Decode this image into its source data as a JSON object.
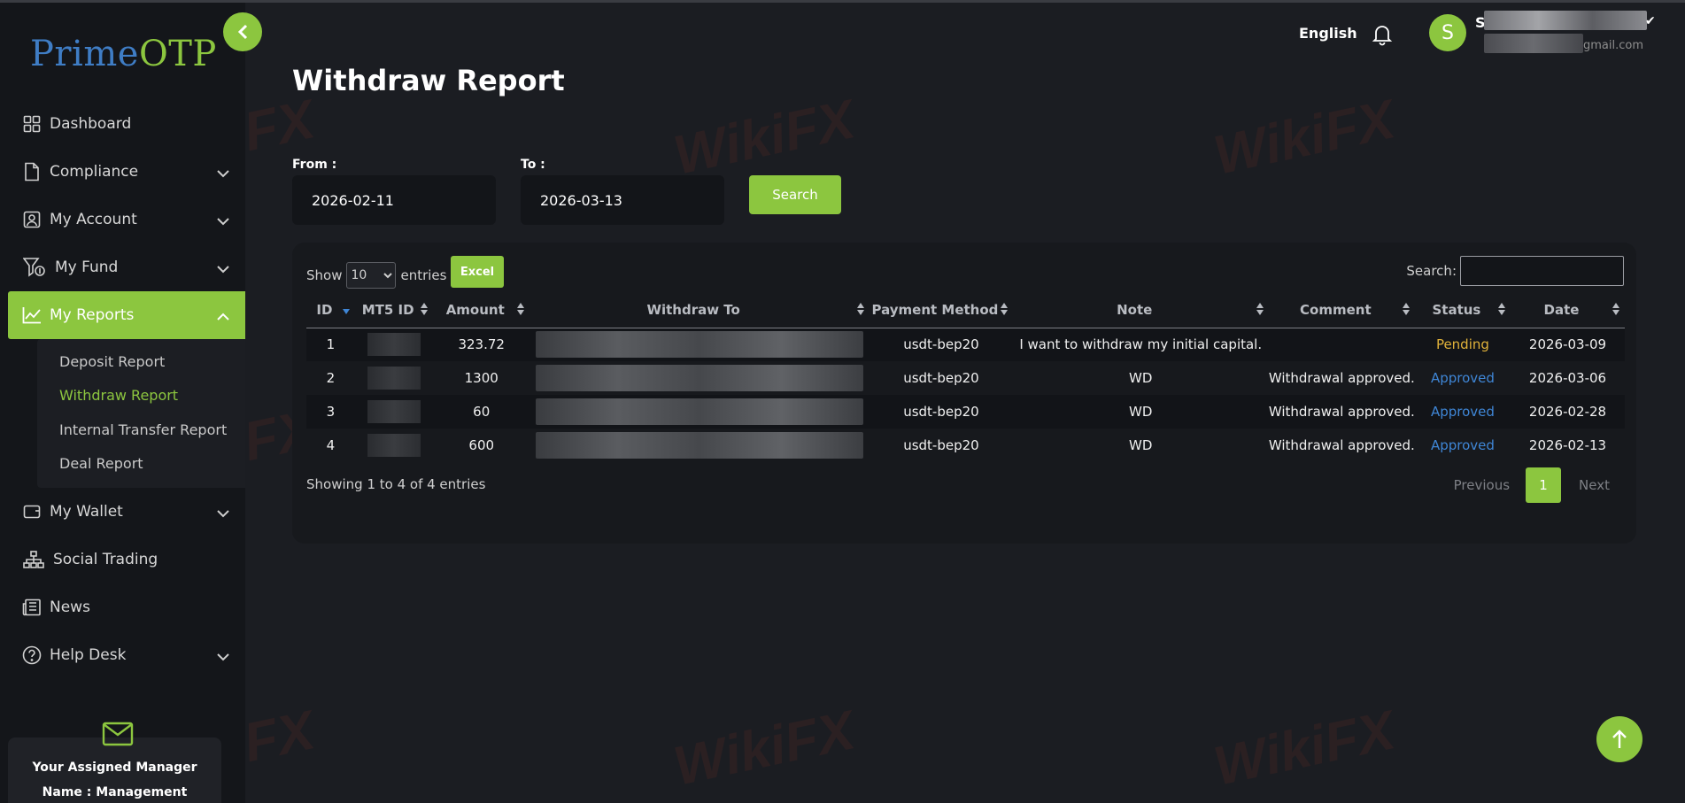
{
  "brand": {
    "part1": "Prime",
    "part2": "OTP"
  },
  "header": {
    "language": "English",
    "avatar_initial": "S",
    "user_name": "S",
    "user_email": "gmail.com"
  },
  "sidebar": {
    "items": [
      {
        "label": "Dashboard",
        "icon": "dashboard-icon"
      },
      {
        "label": "Compliance",
        "icon": "document-icon"
      },
      {
        "label": "My Account",
        "icon": "user-icon"
      },
      {
        "label": "My Fund",
        "icon": "fund-icon"
      },
      {
        "label": "My Reports",
        "icon": "chart-icon"
      },
      {
        "label": "My Wallet",
        "icon": "wallet-icon"
      },
      {
        "label": "Social Trading",
        "icon": "network-icon"
      },
      {
        "label": "News",
        "icon": "news-icon"
      },
      {
        "label": "Help Desk",
        "icon": "help-icon"
      }
    ],
    "reports_sub": [
      "Deposit Report",
      "Withdraw Report",
      "Internal Transfer Report",
      "Deal Report"
    ],
    "manager_title": "Your Assigned Manager",
    "manager_name": "Name : Management"
  },
  "page": {
    "title": "Withdraw Report"
  },
  "filter": {
    "from_label": "From :",
    "from_value": "2026-02-11",
    "to_label": "To :",
    "to_value": "2026-03-13",
    "search_label": "Search"
  },
  "table": {
    "show_label": "Show",
    "entries_label": "entries",
    "page_size": "10",
    "excel_label": "Excel",
    "search_label": "Search:",
    "headers": [
      "ID",
      "MT5 ID",
      "Amount",
      "Withdraw To",
      "Payment Method",
      "Note",
      "Comment",
      "Status",
      "Date"
    ],
    "rows": [
      {
        "id": "1",
        "amount": "323.72",
        "method": "usdt-bep20",
        "note": "I want to withdraw my initial capital.",
        "comment": "",
        "status": "Pending",
        "date": "2026-03-09"
      },
      {
        "id": "2",
        "amount": "1300",
        "method": "usdt-bep20",
        "note": "WD",
        "comment": "Withdrawal approved.",
        "status": "Approved",
        "date": "2026-03-06"
      },
      {
        "id": "3",
        "amount": "60",
        "method": "usdt-bep20",
        "note": "WD",
        "comment": "Withdrawal approved.",
        "status": "Approved",
        "date": "2026-02-28"
      },
      {
        "id": "4",
        "amount": "600",
        "method": "usdt-bep20",
        "note": "WD",
        "comment": "Withdrawal approved.",
        "status": "Approved",
        "date": "2026-02-13"
      }
    ],
    "info": "Showing 1 to 4 of 4 entries",
    "pager": {
      "previous": "Previous",
      "current": "1",
      "next": "Next"
    }
  },
  "watermark": "WikiFX",
  "colors": {
    "accent": "#8cc63f",
    "pending": "#e0b23a",
    "approved": "#3f86d6",
    "background": "#1b1d22",
    "sidebar": "#14161a"
  }
}
